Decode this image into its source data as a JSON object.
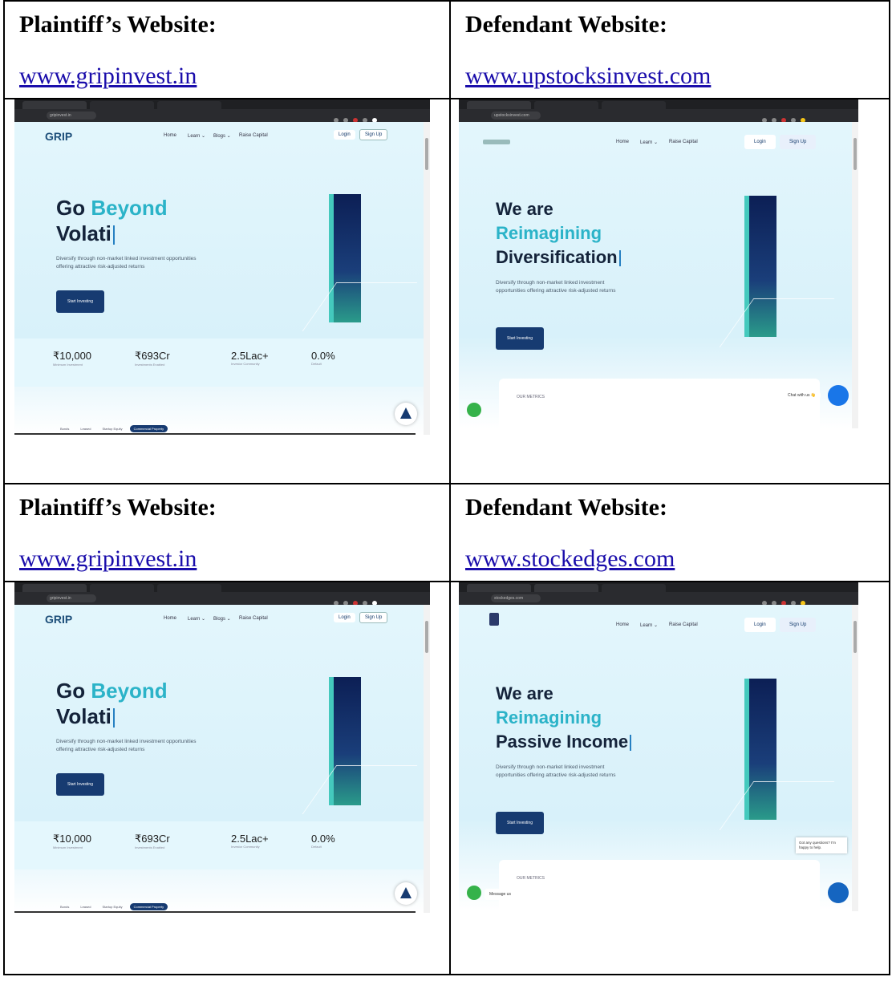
{
  "rows": [
    {
      "left": {
        "title": "Plaintiff’s Website:",
        "link": "www.gripinvest.in"
      },
      "right": {
        "title": "Defendant Website:",
        "link": "www.upstocksinvest.com"
      },
      "left_shot": {
        "url": "gripinvest.in",
        "logo": "GRIP",
        "nav": [
          "Home",
          "Learn ⌄",
          "Blogs ⌄",
          "Raise Capital"
        ],
        "login": "Login",
        "signup": "Sign Up",
        "h1_a": "Go ",
        "h1_b": "Beyond",
        "h1_c": "Volati",
        "desc": "Diversify through non-market linked investment opportunities offering attractive risk-adjusted returns",
        "cta": "Start Investing",
        "stats": [
          {
            "v": "₹10,000",
            "l": "Minimum Investment"
          },
          {
            "v": "₹693Cr",
            "l": "Investments Enabled"
          },
          {
            "v": "2.5Lac+",
            "l": "Investor Community"
          },
          {
            "v": "0.0%",
            "l": "Default"
          }
        ],
        "pills": [
          "Bonds",
          "Leased",
          "Startup Equity",
          "Commercial Property"
        ]
      },
      "right_shot": {
        "url": "upstocksinvest.com",
        "nav": [
          "Home",
          "Learn ⌄",
          "Raise Capital"
        ],
        "login": "Login",
        "signup": "Sign Up",
        "h1_a": "We are",
        "h1_b": "Reimagining",
        "h1_c": "Diversification",
        "desc": "Diversify through non-market linked investment opportunities offering attractive risk-adjusted returns",
        "cta": "Start Investing",
        "metrics": "OUR METRICS",
        "chat": "Chat with us 👋"
      }
    },
    {
      "left": {
        "title": "Plaintiff’s Website:",
        "link": "www.gripinvest.in"
      },
      "right": {
        "title": "Defendant Website:",
        "link": "www.stockedges.com"
      },
      "left_shot": {
        "url": "gripinvest.in",
        "logo": "GRIP",
        "nav": [
          "Home",
          "Learn ⌄",
          "Blogs ⌄",
          "Raise Capital"
        ],
        "login": "Login",
        "signup": "Sign Up",
        "h1_a": "Go ",
        "h1_b": "Beyond",
        "h1_c": "Volati",
        "desc": "Diversify through non-market linked investment opportunities offering attractive risk-adjusted returns",
        "cta": "Start Investing",
        "stats": [
          {
            "v": "₹10,000",
            "l": "Minimum Investment"
          },
          {
            "v": "₹693Cr",
            "l": "Investments Enabled"
          },
          {
            "v": "2.5Lac+",
            "l": "Investor Community"
          },
          {
            "v": "0.0%",
            "l": "Default"
          }
        ],
        "pills": [
          "Bonds",
          "Leased",
          "Startup Equity",
          "Commercial Property"
        ]
      },
      "right_shot": {
        "url": "stockedges.com",
        "nav": [
          "Home",
          "Learn ⌄",
          "Raise Capital"
        ],
        "login": "Login",
        "signup": "Sign Up",
        "h1_a": "We are",
        "h1_b": "Reimagining",
        "h1_c": "Passive Income",
        "desc": "Diversify through non-market linked investment opportunities offering attractive risk-adjusted returns",
        "cta": "Start Investing",
        "metrics": "OUR METRICS",
        "toast": "Got any questions? I'm happy to help.",
        "message": "Message us"
      }
    }
  ]
}
